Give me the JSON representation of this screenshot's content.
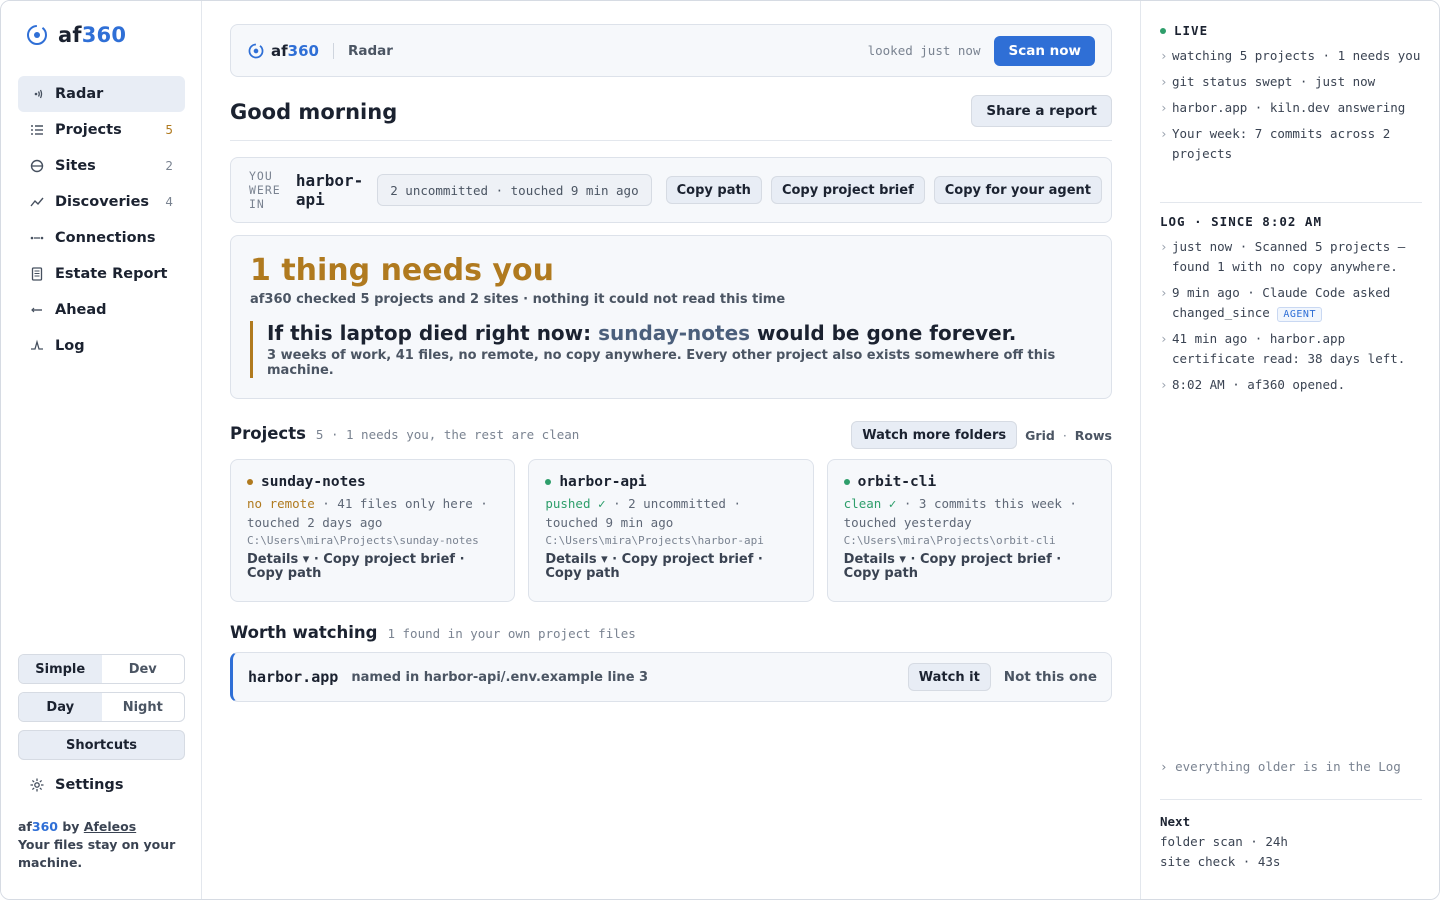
{
  "brand": {
    "name_prefix": "af",
    "name_accent": "360"
  },
  "nav": [
    {
      "label": "Radar",
      "count": "",
      "icon": "radar-icon",
      "active": true
    },
    {
      "label": "Projects",
      "count": "5",
      "icon": "list-icon",
      "warn": true
    },
    {
      "label": "Sites",
      "count": "2",
      "icon": "globe-icon"
    },
    {
      "label": "Discoveries",
      "count": "4",
      "icon": "trend-icon"
    },
    {
      "label": "Connections",
      "count": "",
      "icon": "link-icon"
    },
    {
      "label": "Estate Report",
      "count": "",
      "icon": "document-icon"
    },
    {
      "label": "Ahead",
      "count": "",
      "icon": "arrow-icon"
    },
    {
      "label": "Log",
      "count": "",
      "icon": "pulse-icon"
    }
  ],
  "sidebar": {
    "mode_simple": "Simple",
    "mode_dev": "Dev",
    "theme_day": "Day",
    "theme_night": "Night",
    "shortcuts": "Shortcuts",
    "settings": "Settings",
    "footer_by": "by",
    "footer_author": "Afeleos",
    "footer_note": "Your files stay on your machine."
  },
  "topbar": {
    "section": "Radar",
    "looked": "looked just now",
    "scan": "Scan now"
  },
  "greeting": "Good morning",
  "share": "Share a report",
  "wasin": {
    "label": "YOU WERE IN",
    "project": "harbor-api",
    "status": "2 uncommitted · touched 9 min ago",
    "copy_path": "Copy path",
    "copy_brief": "Copy project brief",
    "copy_agent": "Copy for your agent"
  },
  "needs": {
    "title": "1 thing needs you",
    "sub": "af360 checked 5 projects and 2 sites · nothing it could not read this time",
    "headline_pre": "If this laptop died right now:",
    "headline_proj": "sunday-notes",
    "headline_post": "would be gone forever.",
    "detail": "3 weeks of work, 41 files, no remote, no copy anywhere. Every other project also exists somewhere off this machine."
  },
  "projects": {
    "title": "Projects",
    "sub": "5 · 1 needs you, the rest are clean",
    "watch_more": "Watch more folders",
    "grid": "Grid",
    "rows": "Rows",
    "cards": [
      {
        "name": "sunday-notes",
        "dot": "#b07a1f",
        "status": "no remote",
        "status_color": "#b07a1f",
        "meta": " · 41 files only here · touched 2 days ago",
        "path": "C:\\Users\\mira\\Projects\\sunday-notes",
        "links": "Details ▾ · Copy project brief · Copy path"
      },
      {
        "name": "harbor-api",
        "dot": "#2e9e6b",
        "status": "pushed ✓",
        "status_color": "#2e9e6b",
        "meta": " · 2 uncommitted · touched 9 min ago",
        "path": "C:\\Users\\mira\\Projects\\harbor-api",
        "links": "Details ▾ · Copy project brief · Copy path"
      },
      {
        "name": "orbit-cli",
        "dot": "#2e9e6b",
        "status": "clean ✓",
        "status_color": "#2e9e6b",
        "meta": " · 3 commits this week · touched yesterday",
        "path": "C:\\Users\\mira\\Projects\\orbit-cli",
        "links": "Details ▾ · Copy project brief · Copy path"
      }
    ]
  },
  "worth": {
    "title": "Worth watching",
    "sub": "1 found in your own project files",
    "name": "harbor.app",
    "why": "named in harbor-api/.env.example line 3",
    "watch": "Watch it",
    "dismiss": "Not this one"
  },
  "right": {
    "live": "LIVE",
    "live_items": [
      "watching 5 projects · 1 needs you",
      "git status swept · just now",
      "harbor.app · kiln.dev answering",
      "Your week: 7 commits across 2 projects"
    ],
    "log_title": "LOG · SINCE 8:02 AM",
    "log1": "just now · Scanned 5 projects — found 1 with no copy anywhere.",
    "log2_pre": "9 min ago · Claude Code asked changed_since",
    "log2_badge": "AGENT",
    "log3": "41 min ago · harbor.app certificate read: 38 days left.",
    "log4": "8:02 AM · af360 opened.",
    "older": "everything older is in the Log",
    "next_title": "Next",
    "next1": "folder scan · 24h",
    "next2": "site check · 43s"
  },
  "colors": {
    "accent": "#2f6fd6",
    "warn": "#b07a1f",
    "ok": "#2e9e6b"
  }
}
